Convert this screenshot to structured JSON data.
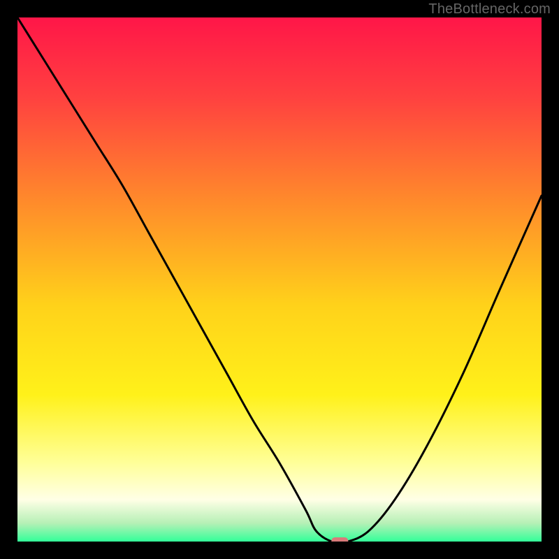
{
  "watermark": "TheBottleneck.com",
  "chart_data": {
    "type": "line",
    "title": "",
    "xlabel": "",
    "ylabel": "",
    "xlim": [
      0,
      100
    ],
    "ylim": [
      0,
      100
    ],
    "grid": false,
    "legend": false,
    "background": {
      "type": "vertical-gradient",
      "stops": [
        {
          "pos": 0.0,
          "color": "#ff1648"
        },
        {
          "pos": 0.15,
          "color": "#ff4040"
        },
        {
          "pos": 0.35,
          "color": "#ff8a2b"
        },
        {
          "pos": 0.55,
          "color": "#ffd21a"
        },
        {
          "pos": 0.72,
          "color": "#fff11a"
        },
        {
          "pos": 0.85,
          "color": "#ffff99"
        },
        {
          "pos": 0.92,
          "color": "#ffffe6"
        },
        {
          "pos": 0.965,
          "color": "#b6f0b6"
        },
        {
          "pos": 1.0,
          "color": "#33ff99"
        }
      ]
    },
    "series": [
      {
        "name": "bottleneck-curve",
        "color": "#000000",
        "x": [
          0,
          5,
          10,
          15,
          20,
          25,
          30,
          35,
          40,
          45,
          50,
          55,
          57,
          60,
          63,
          67,
          72,
          78,
          85,
          92,
          100
        ],
        "y": [
          100,
          92,
          84,
          76,
          68,
          59,
          50,
          41,
          32,
          23,
          15,
          6,
          2,
          0,
          0,
          2,
          8,
          18,
          32,
          48,
          66
        ]
      }
    ],
    "marker": {
      "name": "optimal-point",
      "shape": "rounded-rect",
      "color": "#d97a7a",
      "x": 61.5,
      "y": 0,
      "w": 3.2,
      "h": 1.6
    }
  }
}
